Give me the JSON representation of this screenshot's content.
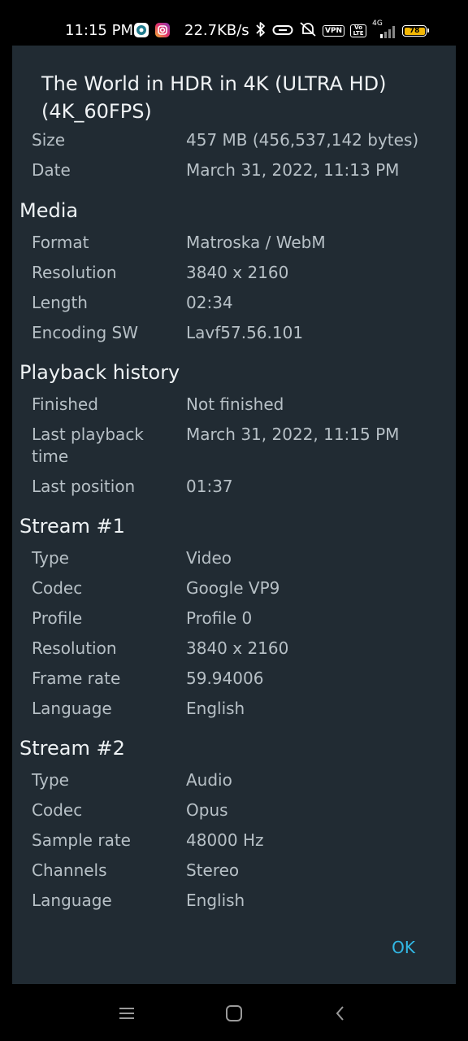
{
  "status_bar": {
    "time": "11:15 PM",
    "net_speed": "22.7KB/s",
    "vpn": "VPN",
    "volte": "Vo LTE",
    "network": "4G",
    "battery": "78",
    "battery_level_percent": 78
  },
  "dialog": {
    "title": "The World in HDR in 4K (ULTRA HD) (4K_60FPS)",
    "general": [
      {
        "label": "Size",
        "value": "457 MB (456,537,142 bytes)"
      },
      {
        "label": "Date",
        "value": "March 31, 2022, 11:13 PM"
      }
    ],
    "media": {
      "heading": "Media",
      "rows": [
        {
          "label": "Format",
          "value": "Matroska / WebM"
        },
        {
          "label": "Resolution",
          "value": "3840 x 2160"
        },
        {
          "label": "Length",
          "value": "02:34"
        },
        {
          "label": "Encoding SW",
          "value": "Lavf57.56.101"
        }
      ]
    },
    "playback": {
      "heading": "Playback history",
      "rows": [
        {
          "label": "Finished",
          "value": "Not finished"
        },
        {
          "label": "Last playback time",
          "value": "March 31, 2022, 11:15 PM"
        },
        {
          "label": "Last position",
          "value": "01:37"
        }
      ]
    },
    "stream1": {
      "heading": "Stream #1",
      "rows": [
        {
          "label": "Type",
          "value": "Video"
        },
        {
          "label": "Codec",
          "value": "Google VP9"
        },
        {
          "label": "Profile",
          "value": "Profile 0"
        },
        {
          "label": "Resolution",
          "value": "3840 x 2160"
        },
        {
          "label": "Frame rate",
          "value": "59.94006"
        },
        {
          "label": "Language",
          "value": "English"
        }
      ]
    },
    "stream2": {
      "heading": "Stream #2",
      "rows": [
        {
          "label": "Type",
          "value": "Audio"
        },
        {
          "label": "Codec",
          "value": "Opus"
        },
        {
          "label": "Sample rate",
          "value": "48000 Hz"
        },
        {
          "label": "Channels",
          "value": "Stereo"
        },
        {
          "label": "Language",
          "value": "English"
        }
      ]
    },
    "ok_label": "OK"
  },
  "colors": {
    "dialog_bg": "#212b33",
    "accent": "#32b9e6",
    "battery": "#f2b705"
  },
  "icons": {
    "status": [
      "app-icon",
      "instagram-icon",
      "bluetooth-icon",
      "link-icon",
      "do-not-disturb-icon",
      "vpn-icon",
      "volte-icon",
      "signal-icon",
      "battery-icon"
    ],
    "nav": [
      "menu-icon",
      "home-icon",
      "back-icon"
    ]
  }
}
